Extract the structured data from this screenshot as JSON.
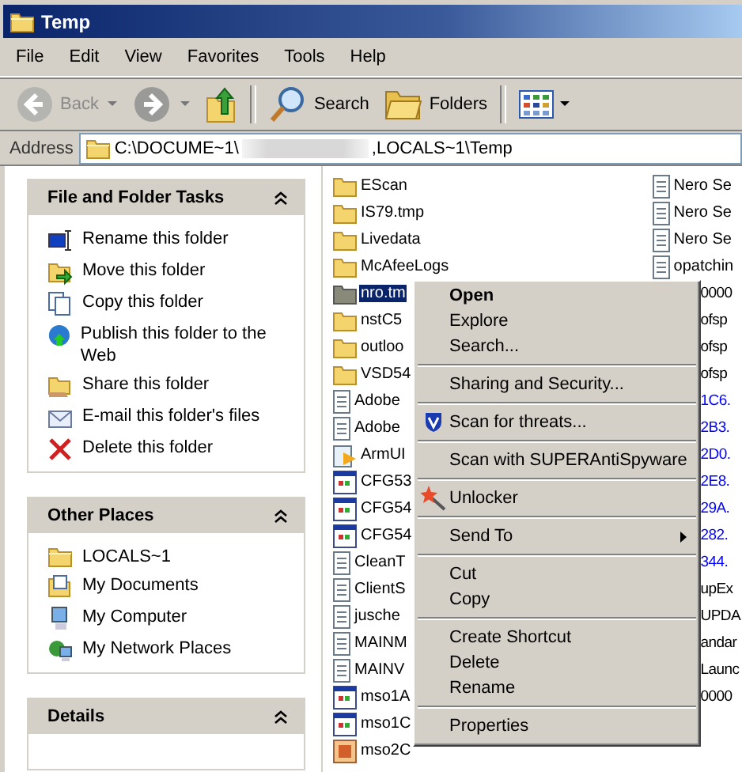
{
  "window": {
    "title": "Temp"
  },
  "menu_bar": [
    "File",
    "Edit",
    "View",
    "Favorites",
    "Tools",
    "Help"
  ],
  "toolbar": [
    {
      "kind": "back",
      "label": "Back",
      "disabled": true
    },
    {
      "kind": "forward",
      "disabled": false
    },
    {
      "kind": "up"
    },
    {
      "kind": "search",
      "label": "Search"
    },
    {
      "kind": "folders",
      "label": "Folders"
    },
    {
      "kind": "views"
    }
  ],
  "address_bar": {
    "label": "Address",
    "path_start": "C:\\DOCUME~1\\",
    "path_end": ",LOCALS~1\\Temp",
    "redacted": true
  },
  "task_panels": [
    {
      "title": "File and Folder Tasks",
      "expanded": true,
      "items": [
        "Rename this folder",
        "Move this folder",
        "Copy this folder",
        "Publish this folder to the Web",
        "Share this folder",
        "E-mail this folder's files",
        "Delete this folder"
      ]
    },
    {
      "title": "Other Places",
      "expanded": true,
      "items": [
        "LOCALS~1",
        "My Documents",
        "My Computer",
        "My Network Places"
      ]
    },
    {
      "title": "Details",
      "expanded": true
    }
  ],
  "files_column_1": [
    {
      "kind": "folder",
      "name": "EScan",
      "selected": false
    },
    {
      "kind": "folder",
      "name": "IS79.tmp",
      "selected": false
    },
    {
      "kind": "folder",
      "name": "Livedata",
      "selected": false
    },
    {
      "kind": "folder",
      "name": "McAfeeLogs",
      "selected": false
    },
    {
      "kind": "folder",
      "name": "nro.tm",
      "selected": true
    },
    {
      "kind": "folder",
      "name": "nstC5",
      "selected": false
    },
    {
      "kind": "folder",
      "name": "outloo",
      "selected": false
    },
    {
      "kind": "folder",
      "name": "VSD54",
      "selected": false
    },
    {
      "kind": "text",
      "name": "Adobe",
      "selected": false
    },
    {
      "kind": "text",
      "name": "Adobe",
      "selected": false
    },
    {
      "kind": "setup",
      "name": "ArmUI",
      "selected": false
    },
    {
      "kind": "app",
      "name": "CFG53",
      "selected": false
    },
    {
      "kind": "app",
      "name": "CFG54",
      "selected": false
    },
    {
      "kind": "app",
      "name": "CFG54",
      "selected": false
    },
    {
      "kind": "text",
      "name": "CleanT",
      "selected": false
    },
    {
      "kind": "text",
      "name": "ClientS",
      "selected": false
    },
    {
      "kind": "text",
      "name": "jusche",
      "selected": false
    },
    {
      "kind": "text",
      "name": "MAINM",
      "selected": false
    },
    {
      "kind": "text",
      "name": "MAINV",
      "selected": false
    },
    {
      "kind": "app",
      "name": "mso1A",
      "selected": false
    },
    {
      "kind": "app",
      "name": "mso1C",
      "selected": false
    },
    {
      "kind": "image",
      "name": "mso2C",
      "selected": false
    }
  ],
  "files_column_2": [
    {
      "kind": "text",
      "name": "Nero Se",
      "compressed": false
    },
    {
      "kind": "text",
      "name": "Nero Se",
      "compressed": false
    },
    {
      "kind": "text",
      "name": "Nero Se",
      "compressed": false
    },
    {
      "kind": "text",
      "name": "opatchin",
      "compressed": false
    },
    {
      "kind": "covered",
      "name": "0000",
      "compressed": false
    },
    {
      "kind": "covered",
      "name": "ofsp",
      "compressed": false
    },
    {
      "kind": "covered",
      "name": "ofsp",
      "compressed": false
    },
    {
      "kind": "covered",
      "name": "ofsp",
      "compressed": false
    },
    {
      "kind": "covered",
      "name": "1C6.",
      "compressed": true
    },
    {
      "kind": "covered",
      "name": "2B3.",
      "compressed": true
    },
    {
      "kind": "covered",
      "name": "2D0.",
      "compressed": true
    },
    {
      "kind": "covered",
      "name": "2E8.",
      "compressed": true
    },
    {
      "kind": "covered",
      "name": "29A.",
      "compressed": true
    },
    {
      "kind": "covered",
      "name": "282.",
      "compressed": true
    },
    {
      "kind": "covered",
      "name": "344.",
      "compressed": true
    },
    {
      "kind": "covered",
      "name": "upEx",
      "compressed": false
    },
    {
      "kind": "covered",
      "name": "UPDA",
      "compressed": false
    },
    {
      "kind": "covered",
      "name": "andar",
      "compressed": false
    },
    {
      "kind": "covered",
      "name": "Launc",
      "compressed": false
    },
    {
      "kind": "covered",
      "name": "0000",
      "compressed": false
    }
  ],
  "context_menu": [
    {
      "kind": "item",
      "label": "Open",
      "default": true,
      "submenu": false
    },
    {
      "kind": "item",
      "label": "Explore",
      "default": false,
      "submenu": false
    },
    {
      "kind": "item",
      "label": "Search...",
      "default": false,
      "submenu": false
    },
    {
      "kind": "separator"
    },
    {
      "kind": "item",
      "label": "Sharing and Security...",
      "default": false,
      "submenu": false
    },
    {
      "kind": "separator"
    },
    {
      "kind": "item",
      "label": "Scan for threats...",
      "default": false,
      "submenu": false
    },
    {
      "kind": "separator"
    },
    {
      "kind": "item",
      "label": "Scan with SUPERAntiSpyware",
      "default": false,
      "submenu": false
    },
    {
      "kind": "separator"
    },
    {
      "kind": "item",
      "label": "Unlocker",
      "default": false,
      "submenu": false
    },
    {
      "kind": "separator"
    },
    {
      "kind": "item",
      "label": "Send To",
      "default": false,
      "submenu": true
    },
    {
      "kind": "separator"
    },
    {
      "kind": "item",
      "label": "Cut",
      "default": false,
      "submenu": false
    },
    {
      "kind": "item",
      "label": "Copy",
      "default": false,
      "submenu": false
    },
    {
      "kind": "separator"
    },
    {
      "kind": "item",
      "label": "Create Shortcut",
      "default": false,
      "submenu": false
    },
    {
      "kind": "item",
      "label": "Delete",
      "default": false,
      "submenu": false
    },
    {
      "kind": "item",
      "label": "Rename",
      "default": false,
      "submenu": false
    },
    {
      "kind": "separator"
    },
    {
      "kind": "item",
      "label": "Properties",
      "default": false,
      "submenu": false
    }
  ]
}
